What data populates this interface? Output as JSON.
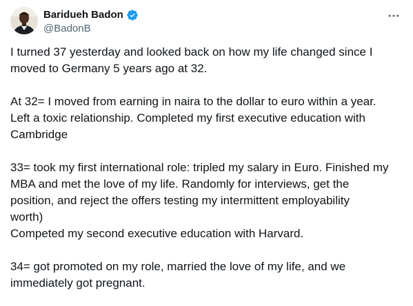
{
  "author": {
    "display_name": "Baridueh Badon",
    "handle": "@BadonB",
    "verified": true,
    "avatar_icon": "profile-photo",
    "verified_icon": "verified-badge-icon",
    "verified_color": "#1d9bf0"
  },
  "actions": {
    "more_icon": "more-horizontal-icon"
  },
  "tweet": {
    "text": "I turned 37 yesterday and looked back on how my life changed since I\nmoved to Germany 5 years ago at 32.\n\nAt 32= I moved from earning  in naira to the dollar to euro within a year.\nLeft a toxic relationship. Completed my first executive education with\nCambridge\n\n33= took my first international role: tripled my salary in Euro. Finished my\nMBA and met the love of my life. Randomly for interviews, get the\nposition, and reject the offers  testing my intermittent employability\nworth)\nCompeted my second executive education with Harvard.\n\n34= got promoted on my role, married the love of my life, and we\nimmediately got pregnant."
  }
}
